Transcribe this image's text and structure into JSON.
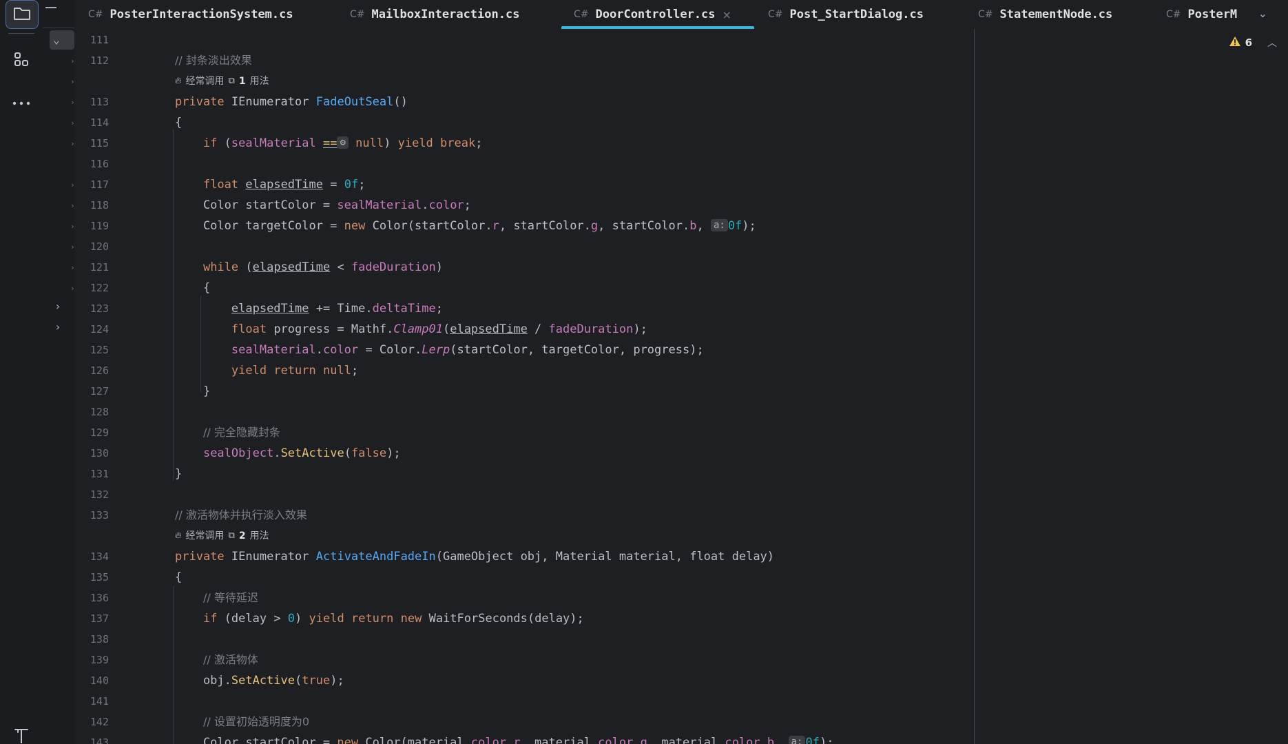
{
  "tabs": [
    {
      "lang": "C#",
      "label": "PosterInteractionSystem.cs"
    },
    {
      "lang": "C#",
      "label": "MailboxInteraction.cs"
    },
    {
      "lang": "C#",
      "label": "DoorController.cs"
    },
    {
      "lang": "C#",
      "label": "Post_StartDialog.cs"
    },
    {
      "lang": "C#",
      "label": "StatementNode.cs"
    },
    {
      "lang": "C#",
      "label": "PosterM"
    }
  ],
  "active_tab": "DoorController.cs",
  "close_symbol": "×",
  "tab_overflow_symbol": "⌄",
  "inspections": {
    "warnings": "6",
    "icon": "warning-triangle"
  },
  "hints": {
    "fadeout": {
      "usage_label": "经常调用",
      "count": "1",
      "usages_label": "用法"
    },
    "activate": {
      "usage_label": "经常调用",
      "count": "2",
      "usages_label": "用法"
    }
  },
  "line_numbers": [
    "111",
    "112",
    "113",
    "114",
    "115",
    "116",
    "117",
    "118",
    "119",
    "120",
    "121",
    "122",
    "123",
    "124",
    "125",
    "126",
    "127",
    "128",
    "129",
    "130",
    "131",
    "132",
    "133",
    "134",
    "135",
    "136",
    "137",
    "138",
    "139",
    "140",
    "141",
    "142",
    "143"
  ],
  "code": {
    "c112": "// 封条淡出效果",
    "c133": "// 激活物体并执行淡入效果",
    "c129": "// 完全隐藏封条",
    "c136": "// 等待延迟",
    "c139": "// 激活物体",
    "c142": "// 设置初始透明度为0",
    "kw_private": "private",
    "ty_ienum": "IEnumerator",
    "fn_fadeout": "FadeOutSeal",
    "fn_activate": "ActivateAndFadeIn",
    "params_activate": "(GameObject obj, Material material, float delay)",
    "inlay_a": "a:",
    "inlay_eq": "⚙"
  }
}
